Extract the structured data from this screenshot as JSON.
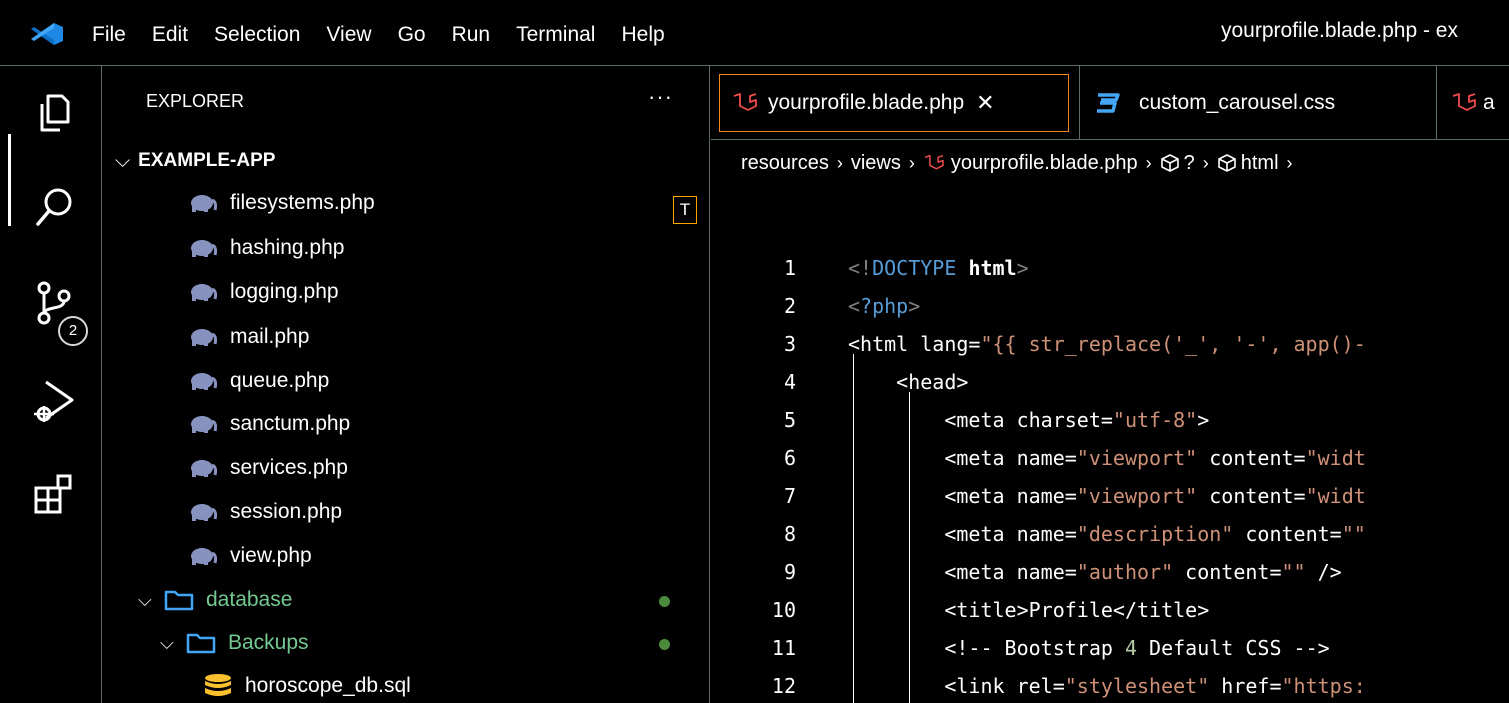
{
  "menu": [
    "File",
    "Edit",
    "Selection",
    "View",
    "Go",
    "Run",
    "Terminal",
    "Help"
  ],
  "window_title": "yourprofile.blade.php - ex",
  "activity": {
    "source_control_badge": "2"
  },
  "sidebar": {
    "title": "EXPLORER",
    "more": "···",
    "project": "EXAMPLE-APP",
    "config_files": [
      "filesystems.php",
      "hashing.php",
      "logging.php",
      "mail.php",
      "queue.php",
      "sanctum.php",
      "services.php",
      "session.php",
      "view.php"
    ],
    "t_badge": "T",
    "database_folder": "database",
    "backups_folder": "Backups",
    "sql_file": "horoscope_db.sql"
  },
  "tabs": [
    {
      "label": "yourprofile.blade.php",
      "active": true
    },
    {
      "label": "custom_carousel.css",
      "active": false
    },
    {
      "label": "a",
      "active": false
    }
  ],
  "breadcrumb": [
    "resources",
    "views",
    "yourprofile.blade.php",
    "?",
    "html"
  ],
  "code": {
    "line_numbers": [
      "1",
      "2",
      "3",
      "4",
      "5",
      "6",
      "7",
      "8",
      "9",
      "10",
      "11",
      "12"
    ]
  },
  "colors": {
    "accent_tab_border": "#f38518",
    "git_modified_green": "#73c991",
    "blade_red": "#f14c4c",
    "css_blue": "#42a5f5",
    "php_purple": "#7f7fb6"
  }
}
